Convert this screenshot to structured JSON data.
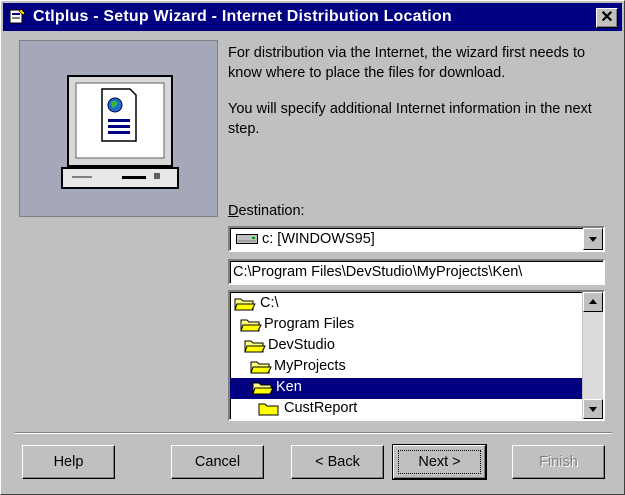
{
  "window": {
    "title": "Ctlplus - Setup Wizard - Internet Distribution Location",
    "close_label": "✕"
  },
  "description": {
    "para1": "For distribution via the Internet, the wizard first needs to know where to place the files for download.",
    "para2": "You will specify additional Internet information in the next step."
  },
  "destination": {
    "label_accel": "D",
    "label_rest": "estination:",
    "drive": "c: [WINDOWS95]",
    "path": "C:\\Program Files\\DevStudio\\MyProjects\\Ken\\"
  },
  "folders": [
    {
      "name": "C:\\",
      "state": "open"
    },
    {
      "name": "Program Files",
      "state": "open"
    },
    {
      "name": "DevStudio",
      "state": "open"
    },
    {
      "name": "MyProjects",
      "state": "open"
    },
    {
      "name": "Ken",
      "state": "open",
      "selected": true
    },
    {
      "name": "CustReport",
      "state": "closed"
    }
  ],
  "buttons": {
    "help": "Help",
    "cancel": "Cancel",
    "back": "< Back",
    "next": "Next >",
    "finish": "Finish"
  },
  "colors": {
    "titlebar": "#000080",
    "face": "#c0c0c0",
    "selection": "#000080"
  }
}
